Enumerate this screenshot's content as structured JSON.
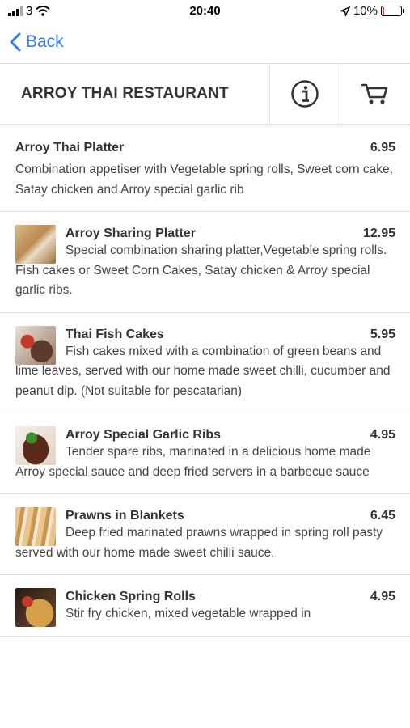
{
  "status_bar": {
    "carrier": "3",
    "time": "20:40",
    "battery": "10%",
    "battery_level": 0.1
  },
  "nav": {
    "back_label": "Back"
  },
  "header": {
    "title": "ARROY THAI RESTAURANT",
    "info_icon": "info-icon",
    "cart_icon": "cart-icon"
  },
  "menu_items": [
    {
      "name": "Arroy Thai Platter",
      "price": "6.95",
      "description": "Combination appetiser with Vegetable spring rolls, Sweet corn cake, Satay chicken and Arroy special garlic rib"
    },
    {
      "name": "Arroy Sharing Platter",
      "price": "12.95",
      "description": "Special combination sharing platter,Vegetable spring rolls. Fish cakes or Sweet Corn Cakes, Satay chicken & Arroy special garlic ribs."
    },
    {
      "name": "Thai Fish Cakes",
      "price": "5.95",
      "description": "Fish cakes mixed with a combination of green beans and lime leaves, served with our home made sweet chilli, cucumber and peanut dip. (Not suitable for pescatarian)"
    },
    {
      "name": "Arroy Special Garlic Ribs",
      "price": "4.95",
      "description": "Tender spare ribs, marinated in a delicious home made Arroy special sauce and deep fried servers in a barbecue sauce"
    },
    {
      "name": "Prawns in Blankets",
      "price": "6.45",
      "description": "Deep fried marinated prawns wrapped in spring roll pasty served with our home made sweet chilli sauce."
    },
    {
      "name": "Chicken Spring Rolls",
      "price": "4.95",
      "description": "Stir fry chicken, mixed vegetable wrapped in"
    }
  ]
}
